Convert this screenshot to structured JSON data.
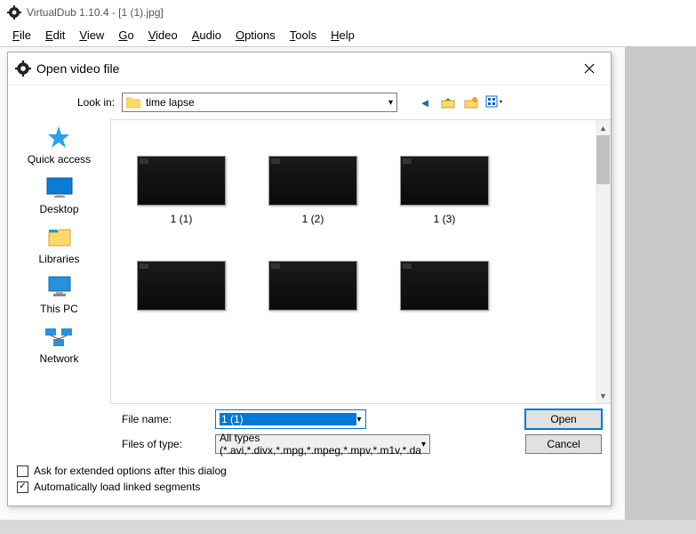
{
  "app": {
    "title": "VirtualDub 1.10.4 - [1 (1).jpg]"
  },
  "menu": [
    "File",
    "Edit",
    "View",
    "Go",
    "Video",
    "Audio",
    "Options",
    "Tools",
    "Help"
  ],
  "dialog": {
    "title": "Open video file",
    "look_in_label": "Look in:",
    "current_folder": "time lapse",
    "toolbar_icons": [
      "back-icon",
      "up-folder-icon",
      "new-folder-icon",
      "views-menu-icon"
    ]
  },
  "places": [
    {
      "id": "quick-access",
      "label": "Quick access"
    },
    {
      "id": "desktop",
      "label": "Desktop"
    },
    {
      "id": "libraries",
      "label": "Libraries"
    },
    {
      "id": "this-pc",
      "label": "This PC"
    },
    {
      "id": "network",
      "label": "Network"
    }
  ],
  "files": [
    {
      "name": "1 (1)"
    },
    {
      "name": "1 (2)"
    },
    {
      "name": "1 (3)"
    },
    {
      "name": ""
    },
    {
      "name": ""
    },
    {
      "name": ""
    }
  ],
  "filename": {
    "label": "File name:",
    "value": "1 (1)"
  },
  "filetype": {
    "label": "Files of type:",
    "value": "All types (*.avi,*.divx,*.mpg,*.mpeg,*.mpv,*.m1v,*.da"
  },
  "buttons": {
    "open": "Open",
    "cancel": "Cancel"
  },
  "checks": {
    "extended": "Ask for extended options after this dialog",
    "autoload": "Automatically load linked segments"
  }
}
